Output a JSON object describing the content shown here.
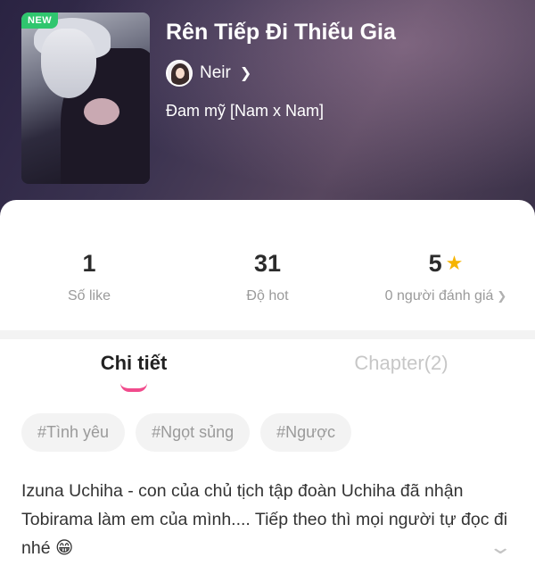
{
  "header": {
    "badge": "NEW",
    "title": "Rên Tiếp Đi Thiếu Gia",
    "author": "Neir",
    "genre": "Đam mỹ [Nam x Nam]"
  },
  "stats": [
    {
      "value": "1",
      "label": "Số like"
    },
    {
      "value": "31",
      "label": "Độ hot"
    },
    {
      "value": "5",
      "label": "0 người đánh giá"
    }
  ],
  "tabs": [
    {
      "label": "Chi tiết",
      "active": true
    },
    {
      "label": "Chapter(2)",
      "active": false
    }
  ],
  "tags": [
    "#Tình yêu",
    "#Ngọt sủng",
    "#Ngược"
  ],
  "description": "Izuna Uchiha - con của chủ tịch tập đoàn Uchiha đã nhận Tobirama làm em của mình.... Tiếp theo thì mọi người tự đọc đi nhé 😁",
  "colors": {
    "accent": "#f14b8c",
    "new_badge": "#2fc66e",
    "star": "#f6b400"
  },
  "icons": {
    "star": "star-icon",
    "chevron_right": "chevron-right-icon",
    "expand": "chevron-down-icon"
  }
}
